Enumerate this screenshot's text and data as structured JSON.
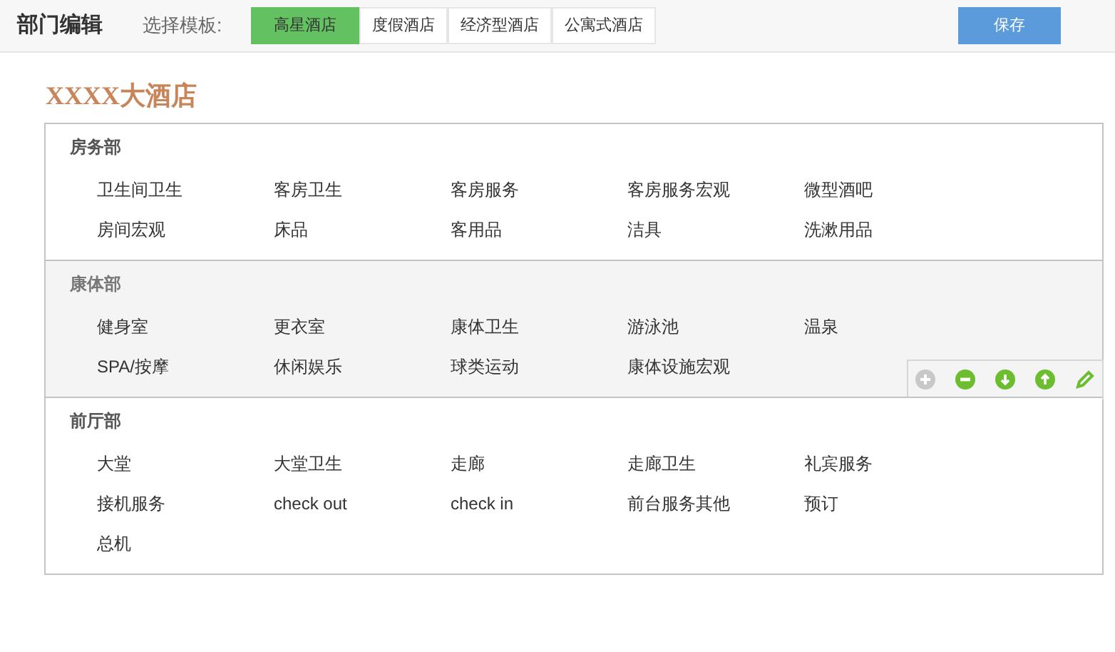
{
  "header": {
    "title": "部门编辑",
    "template_label": "选择模板:",
    "templates": [
      {
        "label": "高星酒店",
        "selected": true
      },
      {
        "label": "度假酒店",
        "selected": false
      },
      {
        "label": "经济型酒店",
        "selected": false
      },
      {
        "label": "公寓式酒店",
        "selected": false
      }
    ],
    "save": "保存"
  },
  "hotel_name": "XXXX大酒店",
  "departments": [
    {
      "name": "房务部",
      "highlighted": false,
      "items": [
        "卫生间卫生",
        "客房卫生",
        "客房服务",
        "客房服务宏观",
        "微型酒吧",
        "房间宏观",
        "床品",
        "客用品",
        "洁具",
        "洗漱用品"
      ]
    },
    {
      "name": "康体部",
      "highlighted": true,
      "items": [
        "健身室",
        "更衣室",
        "康体卫生",
        "游泳池",
        "温泉",
        "SPA/按摩",
        "休闲娱乐",
        "球类运动",
        "康体设施宏观"
      ]
    },
    {
      "name": "前厅部",
      "highlighted": false,
      "items": [
        "大堂",
        "大堂卫生",
        "走廊",
        "走廊卫生",
        "礼宾服务",
        "接机服务",
        "check out",
        "check in",
        "前台服务其他",
        "预订",
        "总机"
      ]
    }
  ],
  "toolbar": [
    {
      "kind": "add",
      "disabled": true
    },
    {
      "kind": "remove",
      "disabled": false
    },
    {
      "kind": "down",
      "disabled": false
    },
    {
      "kind": "up",
      "disabled": false
    },
    {
      "kind": "edit",
      "disabled": false
    }
  ]
}
